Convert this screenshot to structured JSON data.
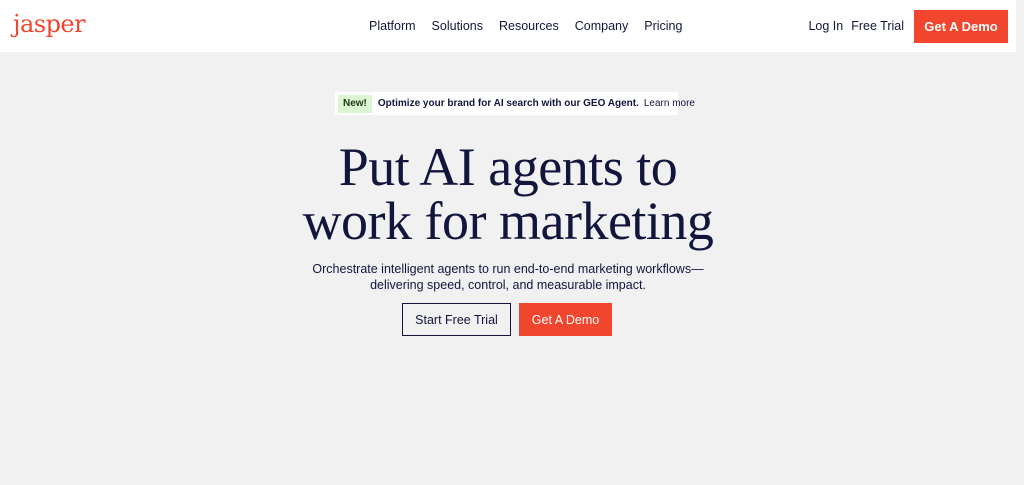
{
  "header": {
    "logo": "jasper",
    "nav": [
      "Platform",
      "Solutions",
      "Resources",
      "Company",
      "Pricing"
    ],
    "login": "Log In",
    "free_trial": "Free Trial",
    "cta": "Get A Demo"
  },
  "banner": {
    "badge": "New!",
    "text": "Optimize your brand for AI search with our GEO Agent.",
    "link": "Learn more",
    "icon": "arrow-right-icon"
  },
  "hero": {
    "title_line1": "Put AI agents to",
    "title_line2": "work for marketing",
    "subtitle_line1": "Orchestrate intelligent agents to run end-to-end marketing workflows—",
    "subtitle_line2": "delivering speed, control, and measurable impact.",
    "primary_cta": "Start Free Trial",
    "secondary_cta": "Get A Demo"
  },
  "colors": {
    "brand": "#f2452e",
    "text": "#12163d",
    "badge_bg": "#dcf5d3",
    "page_bg": "#f1f1f1"
  }
}
